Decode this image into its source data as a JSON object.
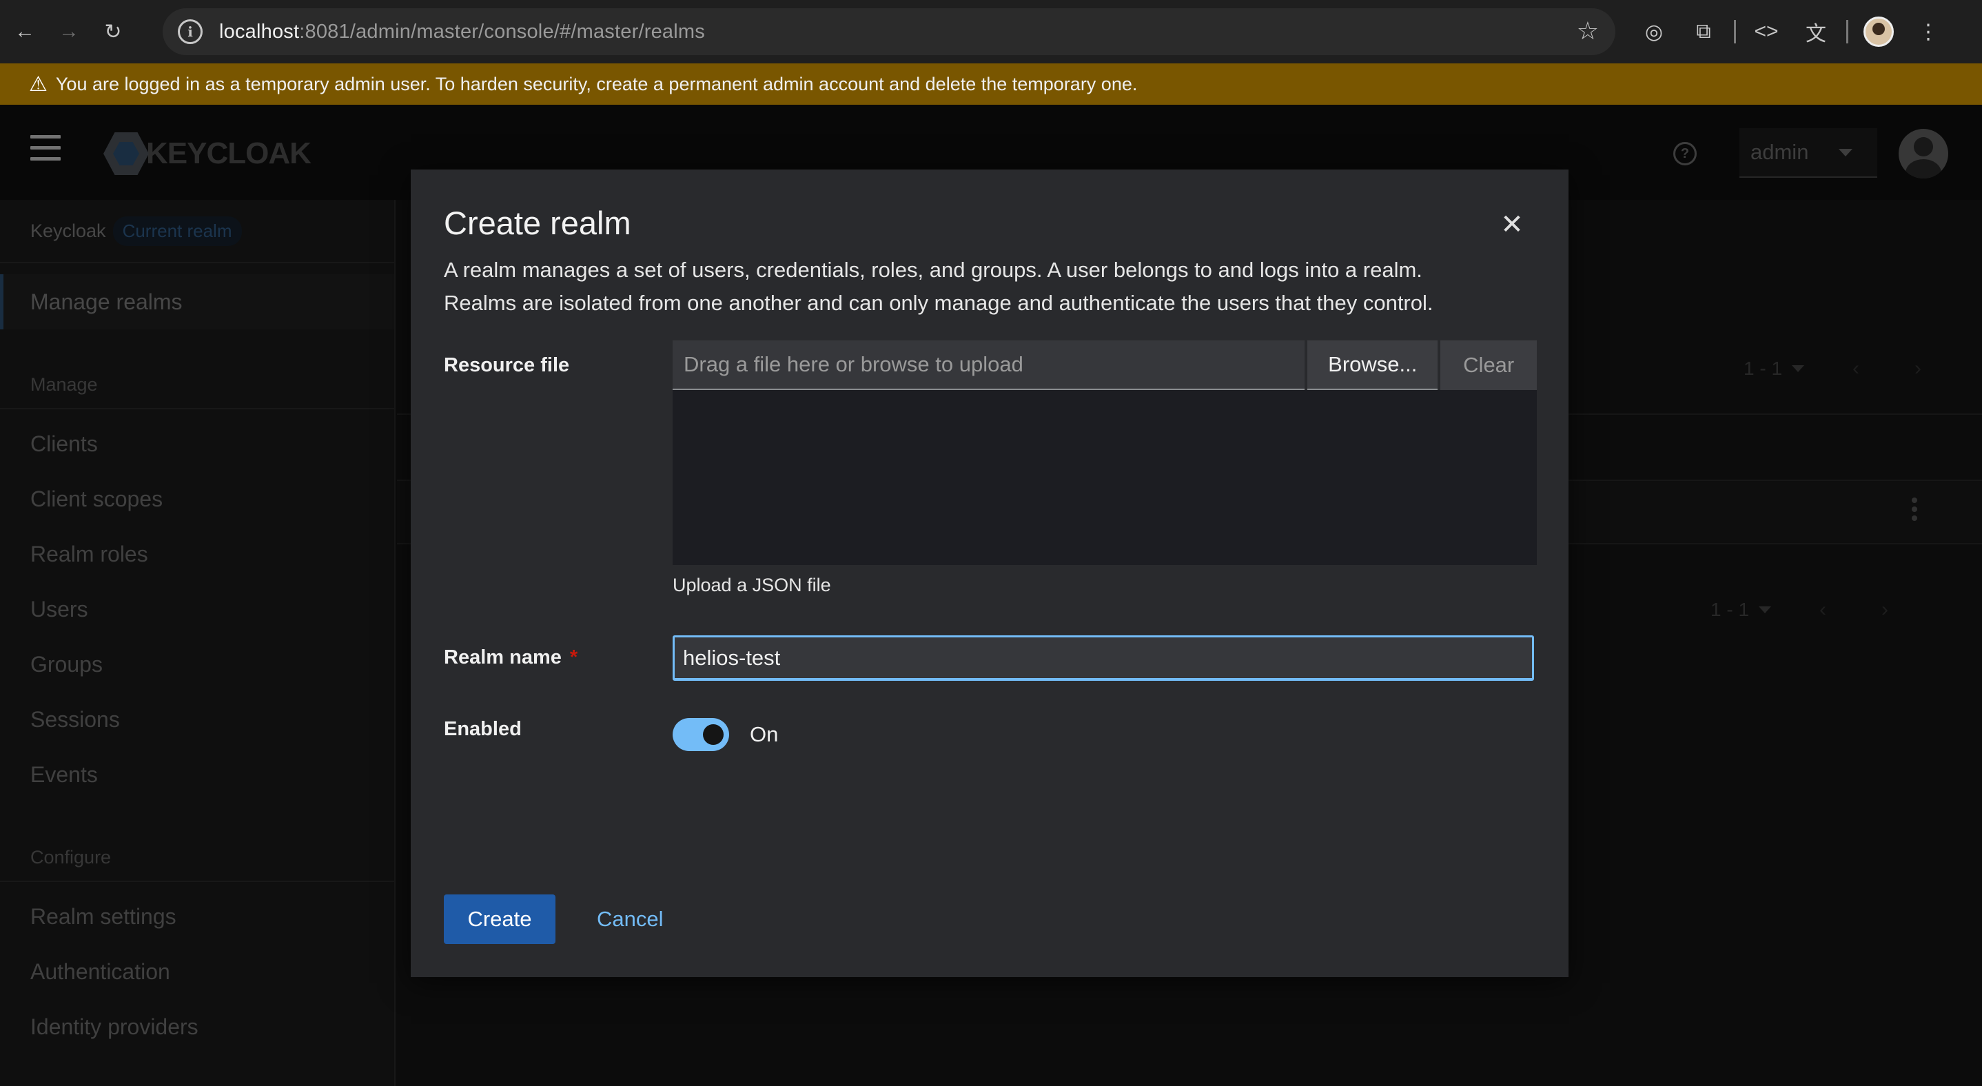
{
  "browser": {
    "url_host": "localhost",
    "url_path": ":8081/admin/master/console/#/master/realms"
  },
  "banner": {
    "text": "You are logged in as a temporary admin user. To harden security, create a permanent admin account and delete the temporary one."
  },
  "header": {
    "logo_text": "KEYCLOAK",
    "user_select_value": "admin"
  },
  "sidebar": {
    "realm_label": "Keycloak",
    "realm_badge": "Current realm",
    "manage_realms": "Manage realms",
    "manage_section": "Manage",
    "manage_items": [
      "Clients",
      "Client scopes",
      "Realm roles",
      "Users",
      "Groups",
      "Sessions",
      "Events"
    ],
    "configure_section": "Configure",
    "configure_items": [
      "Realm settings",
      "Authentication",
      "Identity providers"
    ]
  },
  "main": {
    "pager_top": "1 - 1",
    "pager_bottom": "1 - 1"
  },
  "modal": {
    "title": "Create realm",
    "description_line1": "A realm manages a set of users, credentials, roles, and groups. A user belongs to and logs into a realm.",
    "description_line2": "Realms are isolated from one another and can only manage and authenticate the users that they control.",
    "resource_file_label": "Resource file",
    "file_placeholder": "Drag a file here or browse to upload",
    "browse_label": "Browse...",
    "clear_label": "Clear",
    "upload_helper": "Upload a JSON file",
    "realm_name_label": "Realm name",
    "required_marker": "*",
    "realm_name_value": "helios-test",
    "enabled_label": "Enabled",
    "enabled_state": "On",
    "create_label": "Create",
    "cancel_label": "Cancel"
  },
  "colors": {
    "accent": "#73bcf7",
    "primary_button": "#1f5ba8",
    "banner_bg": "#795600"
  }
}
